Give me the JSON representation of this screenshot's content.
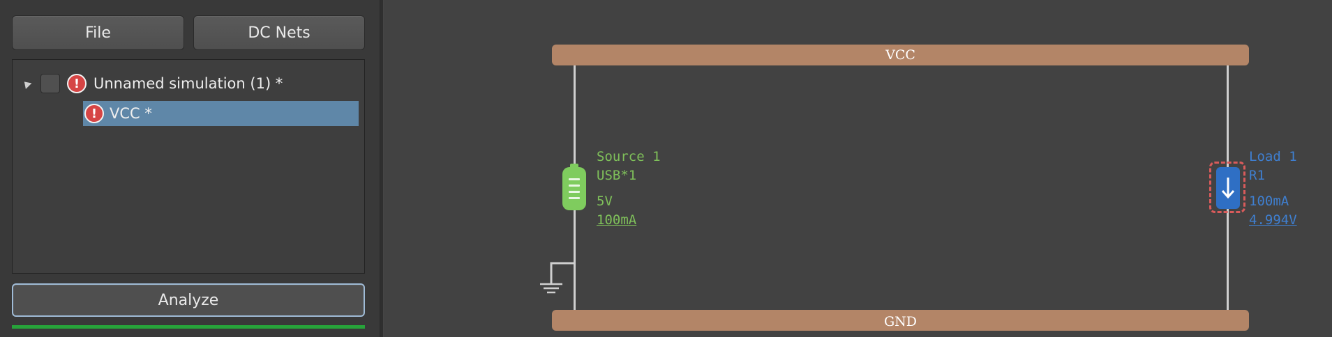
{
  "toolbar": {
    "file_label": "File",
    "dcnets_label": "DC Nets"
  },
  "tree": {
    "simulation": {
      "label": "Unnamed simulation (1) *",
      "icon": "error-icon"
    },
    "net": {
      "label": "VCC *",
      "icon": "error-icon"
    }
  },
  "analyze": {
    "label": "Analyze",
    "progress": 1.0
  },
  "schematic": {
    "rails": {
      "top": "VCC",
      "bottom": "GND"
    },
    "source": {
      "name": "Source 1",
      "part": "USB*1",
      "voltage": "5V",
      "current": "100mA"
    },
    "load": {
      "name": "Load 1",
      "part": "R1",
      "current": "100mA",
      "voltage": "4.994V"
    }
  },
  "colors": {
    "rail": "#b38567",
    "source": "#7fcc5e",
    "load": "#2f6fc4",
    "error": "#d64545",
    "selection": "#5f87a8",
    "progress": "#27a33a"
  }
}
